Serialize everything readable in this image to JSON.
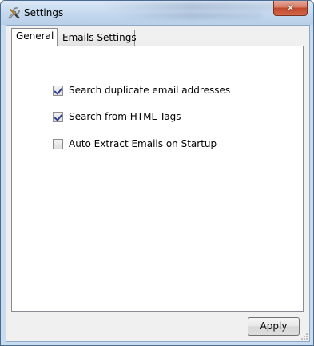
{
  "window": {
    "title": "Settings",
    "close_glyph": "✕",
    "icon": "tools-icon"
  },
  "tabs": [
    {
      "label": "General",
      "active": true
    },
    {
      "label": "Emails Settings",
      "active": false
    }
  ],
  "general": {
    "options": [
      {
        "label": "Search duplicate email addresses",
        "checked": true
      },
      {
        "label": "Search from HTML Tags",
        "checked": true
      },
      {
        "label": "Auto Extract Emails on Startup",
        "checked": false
      }
    ]
  },
  "footer": {
    "apply_label": "Apply"
  },
  "colors": {
    "titlebar": "#c4d8ee",
    "close_button": "#c0492c",
    "client_background": "#f0f0f0",
    "checkmark": "#2a3f8c"
  }
}
